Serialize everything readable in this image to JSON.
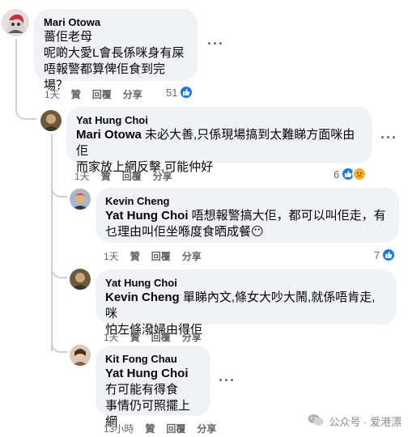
{
  "comments": [
    {
      "author": "Mari Otowa",
      "lines": [
        "薔佢老母",
        "呢啲大愛L會長係咪身有屎",
        "唔報警都算俾佢食到完場？"
      ],
      "time": "1天",
      "like": "贊",
      "reply": "回覆",
      "share": "分享",
      "reactions": "51"
    },
    {
      "author": "Yat Hung Choi",
      "mention": "Mari Otowa",
      "line1": " 未必大善,只係現場搞到太難睇方面咪由佢",
      "line2": "而家放上網反擊,可能仲好",
      "time": "1天",
      "like": "贊",
      "reply": "回覆",
      "share": "分享",
      "reactions": "6"
    },
    {
      "author": "Kevin Cheng",
      "mention": "Yat Hung Choi",
      "line1": " 唔想報警搞大佢，都可以叫佢走，有",
      "line2": "乜理由叫佢坐喺度食晒成餐",
      "emoji": "😶",
      "time": "1天",
      "like": "贊",
      "reply": "回覆",
      "share": "分享",
      "reactions": "7"
    },
    {
      "author": "Yat Hung Choi",
      "mention": "Kevin Cheng",
      "line1": " 單睇內文,條女大吵大鬧,就係唔肯走,咪",
      "line2": "怕左條潑婦由得佢",
      "time": "1天",
      "like": "贊",
      "reply": "回覆",
      "share": "分享"
    },
    {
      "author": "Kit Fong Chau",
      "mention": "Yat Hung Choi",
      "line1": "冇可能有得食",
      "line2": "事情仍可照擺上網",
      "time": "13小時",
      "like": "贊",
      "reply": "回覆",
      "share": "分享"
    }
  ],
  "watermark": {
    "label": "公众号 · 爱港漂"
  },
  "colors": {
    "bubble": "#f0f2f5",
    "like": "#1877f2",
    "sad": "#f7b125",
    "meta": "#65676b"
  }
}
